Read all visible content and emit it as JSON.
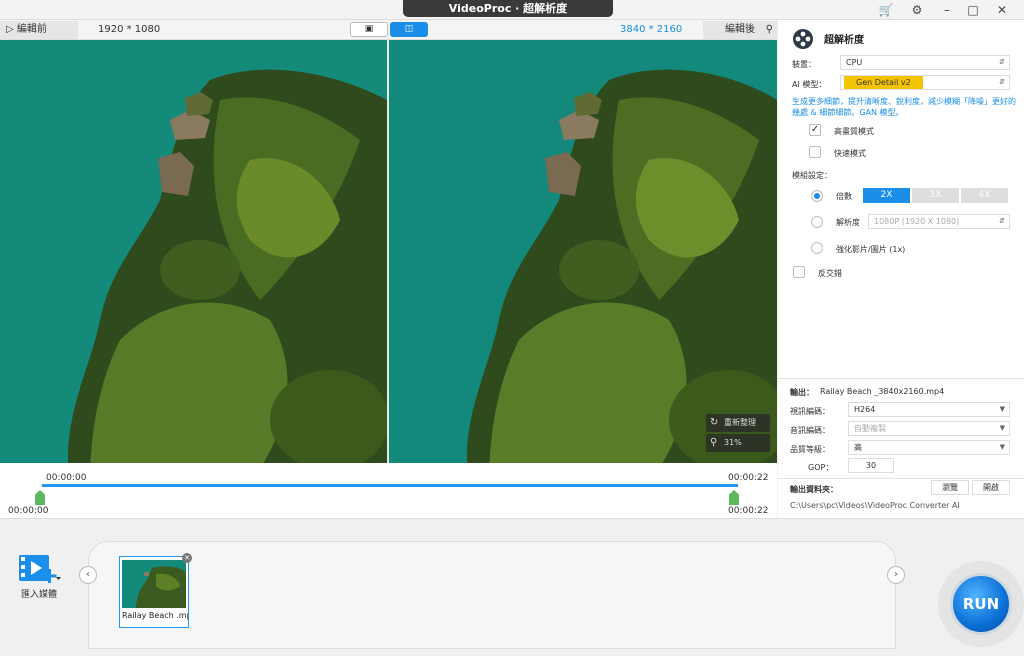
{
  "window": {
    "title": "VideoProc · 超解析度"
  },
  "preview": {
    "before_label": "編輯前",
    "after_label": "編輯後",
    "before_res": "1920 * 1080",
    "after_res": "3840 * 2160",
    "reset_label": "重新整理",
    "zoom_label": "31%"
  },
  "timeline": {
    "start_top": "00:00:00",
    "end_top": "00:00:22",
    "start_bottom": "00:00:00",
    "end_bottom": "00:00:22"
  },
  "settings": {
    "title": "超解析度",
    "device_label": "裝置：",
    "device_value": "CPU",
    "model_label": "AI 模型：",
    "model_value": "Gen Detail v2",
    "description": "生成更多細節，提升清晰度、銳利度，減少模糊「降噪」更好的幾處 & 細節細節。GAN 模型。",
    "hq_mode": "高畫質模式",
    "fast_mode": "快速模式",
    "scale_label": "模組設定：",
    "multiplier_label": "倍數",
    "scale_options": [
      "2X",
      "3X",
      "4X"
    ],
    "resolution_label": "解析度",
    "resolution_value": "1080P (1920 X 1080)",
    "enhance_label": "強化影片/圖片 (1x)",
    "deinterlace_label": "反交錯"
  },
  "output": {
    "label": "輸出：",
    "filename": "Railay Beach _3840x2160.mp4",
    "video_codec_label": "視訊編碼：",
    "video_codec": "H264",
    "audio_codec_label": "音訊編碼：",
    "audio_codec": "自動複製",
    "quality_label": "品質等級：",
    "quality": "高",
    "gop_label": "GOP：",
    "gop": "30",
    "folder_label": "輸出資料夾：",
    "browse_label": "瀏覽",
    "open_label": "開啟",
    "folder_path": "C:\\Users\\pc\\Videos\\VideoProc Converter AI"
  },
  "media": {
    "import_label": "匯入媒體",
    "clip_name": "Railay Beach .mp4"
  },
  "run_label": "RUN",
  "colors": {
    "accent": "#1a8ee8",
    "model_badge": "#f5c400",
    "water": "#138a7a"
  }
}
